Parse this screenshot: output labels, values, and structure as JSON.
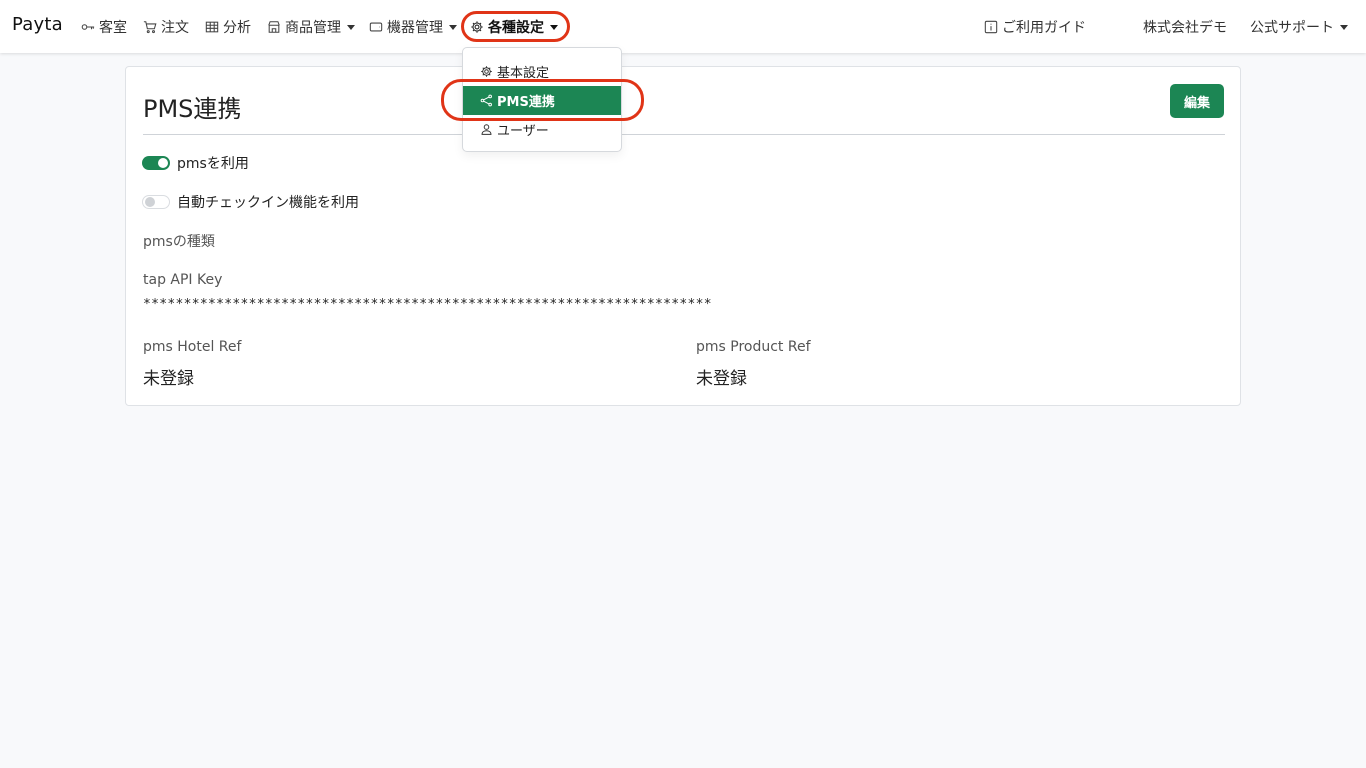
{
  "nav": {
    "brand": "Payta",
    "items": [
      {
        "label": "客室",
        "icon": "key-icon"
      },
      {
        "label": "注文",
        "icon": "cart-icon"
      },
      {
        "label": "分析",
        "icon": "table-icon"
      },
      {
        "label": "商品管理",
        "icon": "shop-icon"
      },
      {
        "label": "機器管理",
        "icon": "device-icon"
      },
      {
        "label": "各種設定",
        "icon": "gear-icon"
      }
    ],
    "guide": "ご利用ガイド",
    "company": "株式会社デモ",
    "support": "公式サポート"
  },
  "dropdown": {
    "items": [
      {
        "label": "基本設定",
        "icon": "gear-icon"
      },
      {
        "label": "PMS連携",
        "icon": "share-icon",
        "active": true
      },
      {
        "label": "ユーザー",
        "icon": "person-icon"
      }
    ]
  },
  "card": {
    "title": "PMS連携",
    "edit_label": "編集",
    "toggles": [
      {
        "label": "pmsを利用",
        "on": true
      },
      {
        "label": "自動チェックイン機能を利用",
        "on": false
      }
    ],
    "pms_type_label": "pmsの種類",
    "api_key_label": "tap API Key",
    "api_key_value": "**********************************************************************",
    "hotel_ref_label": "pms Hotel Ref",
    "hotel_ref_value": "未登録",
    "product_ref_label": "pms Product Ref",
    "product_ref_value": "未登録"
  },
  "colors": {
    "accent": "#1c8654",
    "highlight_ring": "#e03417"
  }
}
